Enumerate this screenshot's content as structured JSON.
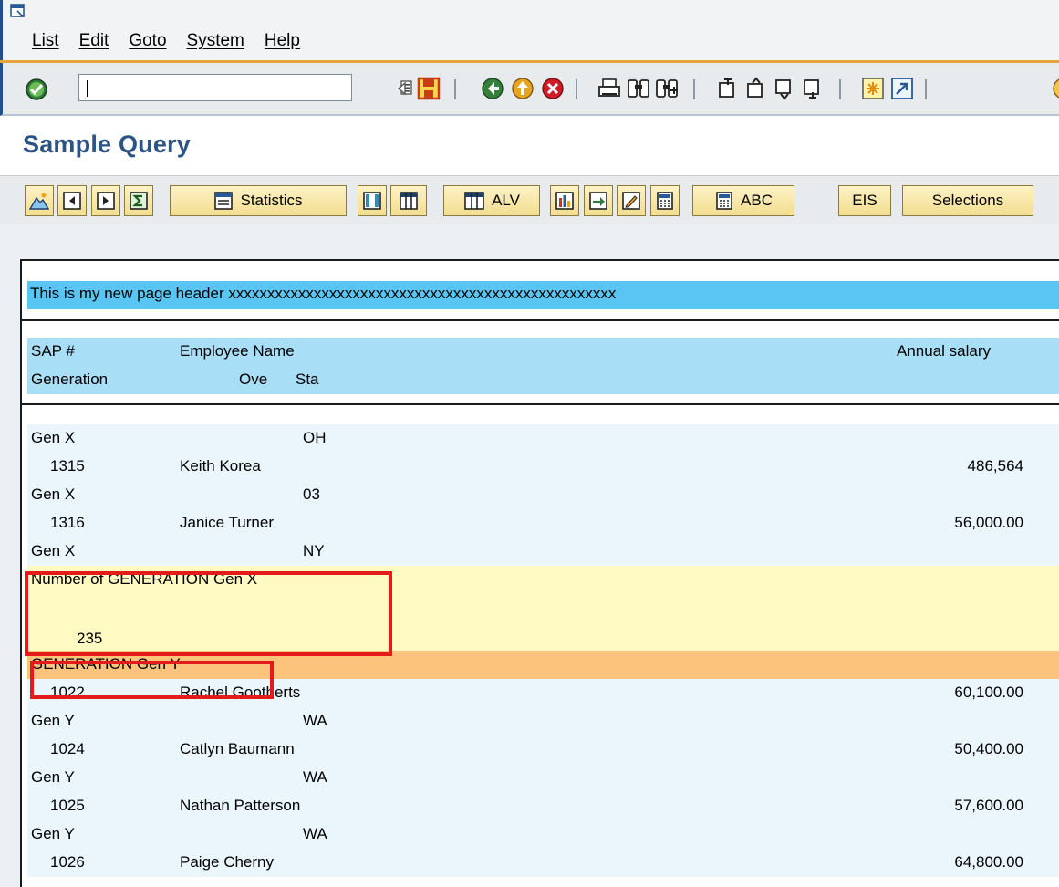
{
  "menu": {
    "items": [
      "List",
      "Edit",
      "Goto",
      "System",
      "Help"
    ]
  },
  "toolbar": {
    "command_value": ""
  },
  "title": "Sample Query",
  "app_toolbar": {
    "statistics_label": "Statistics",
    "alv_label": "ALV",
    "abc_label": "ABC",
    "eis_label": "EIS",
    "selections_label": "Selections"
  },
  "report": {
    "page_header": "This is my new page header xxxxxxxxxxxxxxxxxxxxxxxxxxxxxxxxxxxxxxxxxxxxxxxxxx",
    "col_headers": {
      "sap": "SAP #",
      "name": "Employee Name",
      "salary": "Annual salary",
      "generation": "Generation",
      "ove": "Ove",
      "sta": "Sta"
    },
    "rows": [
      {
        "kind": "gen",
        "generation": "Gen X",
        "state": "OH"
      },
      {
        "kind": "emp",
        "sap": "1315",
        "name": "Keith Korea",
        "salary": "486,564"
      },
      {
        "kind": "gen",
        "generation": "Gen X",
        "state": "03"
      },
      {
        "kind": "emp",
        "sap": "1316",
        "name": "Janice Turner",
        "salary": "56,000.00"
      },
      {
        "kind": "gen",
        "generation": "Gen X",
        "state": "NY"
      },
      {
        "kind": "subtotal",
        "label": "Number of GENERATION Gen X"
      },
      {
        "kind": "blank"
      },
      {
        "kind": "count",
        "value": "235"
      },
      {
        "kind": "group",
        "label": "GENERATION Gen Y"
      },
      {
        "kind": "emp",
        "sap": "1022",
        "name": "Rachel Gootherts",
        "salary": "60,100.00"
      },
      {
        "kind": "gen",
        "generation": "Gen Y",
        "state": "WA"
      },
      {
        "kind": "emp",
        "sap": "1024",
        "name": "Catlyn Baumann",
        "salary": "50,400.00"
      },
      {
        "kind": "gen",
        "generation": "Gen Y",
        "state": "WA"
      },
      {
        "kind": "emp",
        "sap": "1025",
        "name": "Nathan Patterson",
        "salary": "57,600.00"
      },
      {
        "kind": "gen",
        "generation": "Gen Y",
        "state": "WA"
      },
      {
        "kind": "emp",
        "sap": "1026",
        "name": "Paige Cherny",
        "salary": "64,800.00"
      }
    ]
  }
}
